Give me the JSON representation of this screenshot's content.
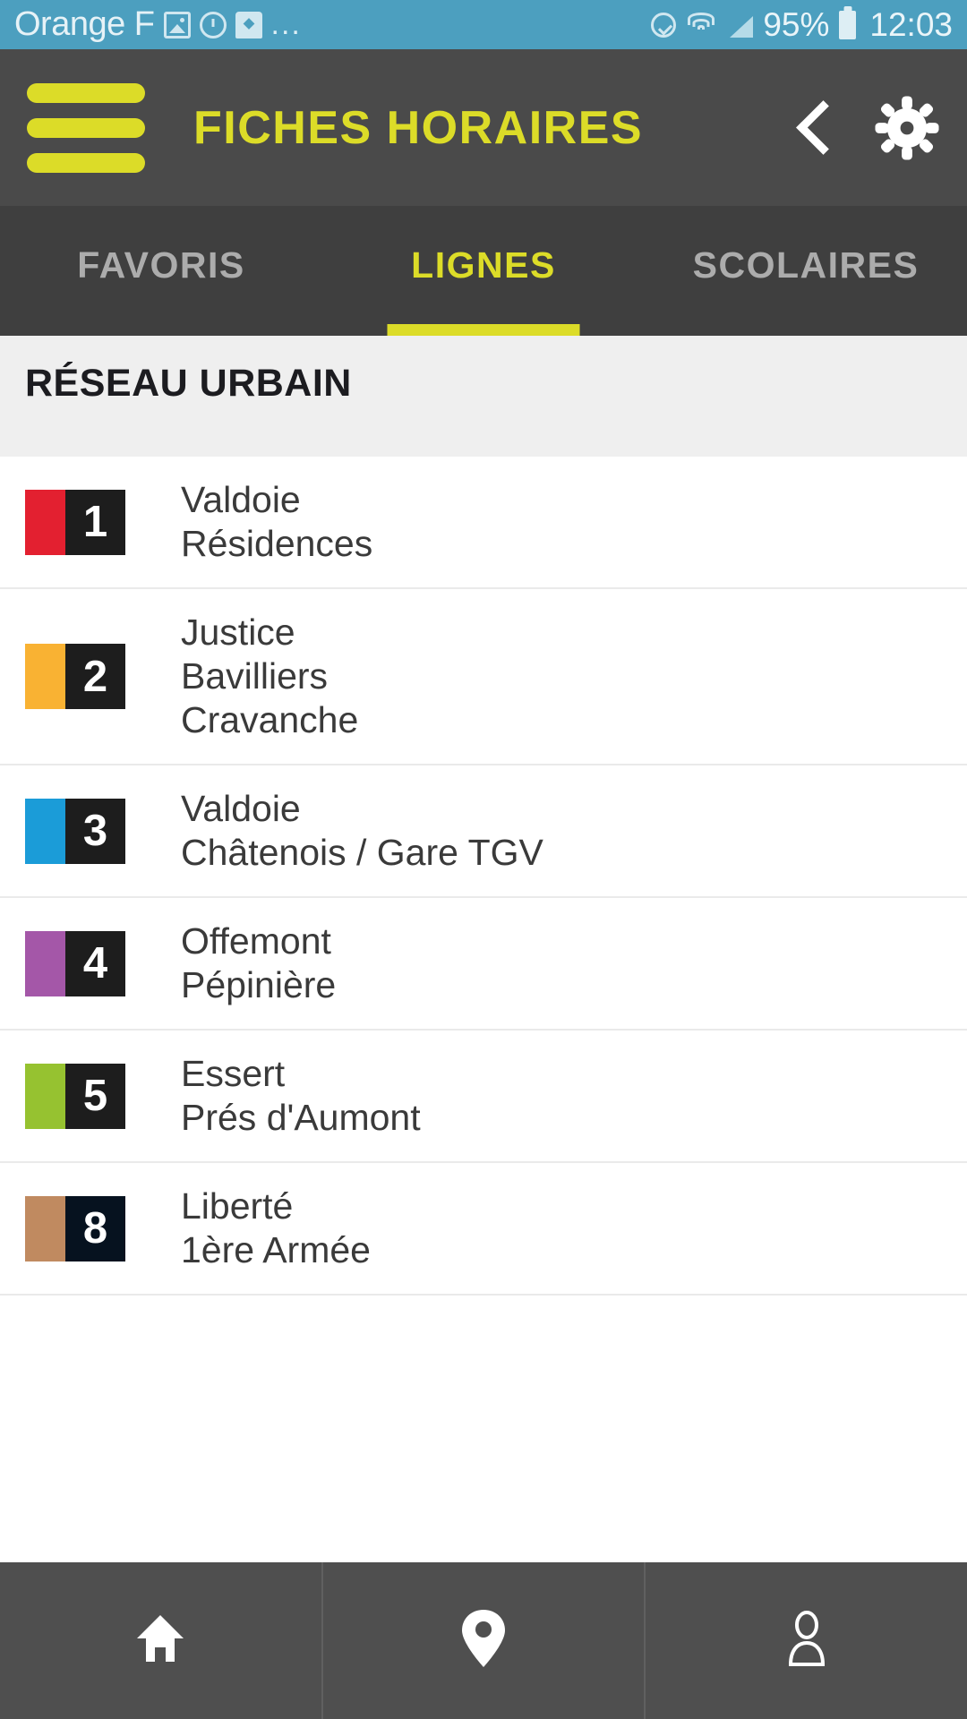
{
  "statusbar": {
    "carrier": "Orange F",
    "overflow_dots": "...",
    "battery_percent": "95%",
    "time": "12:03",
    "icons": [
      "photo-icon",
      "sync-icon",
      "misc-icon",
      "alarm-icon",
      "wifi-icon",
      "signal-icon",
      "battery-icon"
    ]
  },
  "header": {
    "title": "FICHES HORAIRES",
    "menu_icon": "hamburger-menu-icon",
    "back_icon": "chevron-left-icon",
    "settings_icon": "gear-icon",
    "accent_color": "#DCDC28",
    "background_color": "#4A4A4A"
  },
  "tabs": [
    {
      "label": "FAVORIS",
      "active": false
    },
    {
      "label": "LIGNES",
      "active": true
    },
    {
      "label": "SCOLAIRES",
      "active": false
    }
  ],
  "section": {
    "title": "RÉSEAU URBAIN"
  },
  "lines": [
    {
      "number": "1",
      "stripe_color": "#E32030",
      "badge_color": "#1D1D1D",
      "destinations": [
        "Valdoie",
        "Résidences"
      ]
    },
    {
      "number": "2",
      "stripe_color": "#F9B233",
      "badge_color": "#1D1D1D",
      "destinations": [
        "Justice",
        "Bavilliers",
        "Cravanche"
      ]
    },
    {
      "number": "3",
      "stripe_color": "#1B9CD8",
      "badge_color": "#1D1D1D",
      "destinations": [
        "Valdoie",
        "Châtenois / Gare TGV"
      ]
    },
    {
      "number": "4",
      "stripe_color": "#A457A8",
      "badge_color": "#1D1D1D",
      "destinations": [
        "Offemont",
        "Pépinière"
      ]
    },
    {
      "number": "5",
      "stripe_color": "#96C230",
      "badge_color": "#1D1D1D",
      "destinations": [
        "Essert",
        "Prés d'Aumont"
      ]
    },
    {
      "number": "8",
      "stripe_color": "#C08A60",
      "badge_color": "#06121F",
      "destinations": [
        "Liberté",
        "1ère Armée"
      ]
    }
  ],
  "bottom_nav": [
    {
      "icon": "home-icon"
    },
    {
      "icon": "map-pin-icon"
    },
    {
      "icon": "user-profile-icon"
    }
  ]
}
